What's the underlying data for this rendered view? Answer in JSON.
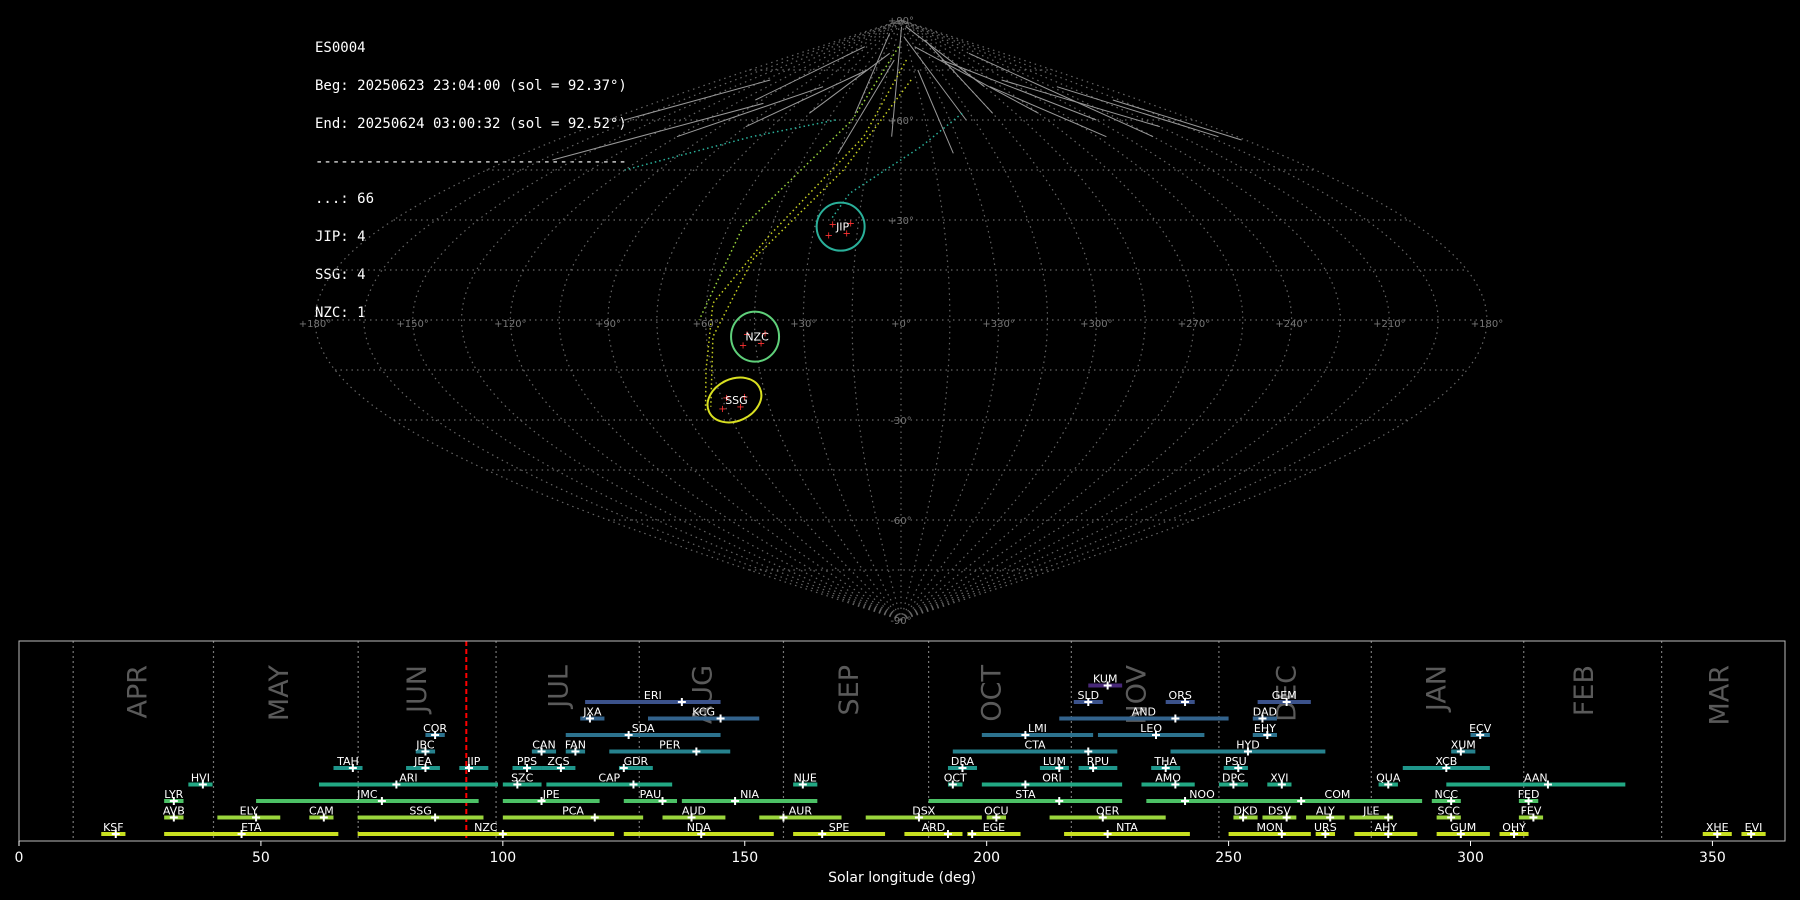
{
  "info": {
    "id": "ES0004",
    "beg": "Beg: 20250623 23:04:00 (sol = 92.37°)",
    "end": "End: 20250624 03:00:32 (sol = 92.52°)",
    "sep": "-------------------------------------",
    "counts": [
      "...: 66",
      "JIP: 4",
      "SSG: 4",
      "NZC: 1"
    ]
  },
  "sky_map": {
    "projection": "sinusoidal",
    "lat_labels": [
      "+90°",
      "+60°",
      "+30°",
      "-30°",
      "-60°",
      "-90°"
    ],
    "lon_labels": [
      "+180°",
      "+150°",
      "+120°",
      "+90°",
      "+60°",
      "+30°",
      "+0°",
      "+330°",
      "+300°",
      "+270°",
      "+240°",
      "+210°",
      "+180°"
    ],
    "radiants": [
      {
        "code": "JIP",
        "color": "#2ab09a"
      },
      {
        "code": "NZC",
        "color": "#5fd07a"
      },
      {
        "code": "SSG",
        "color": "#d9e021"
      }
    ]
  },
  "chart_data": {
    "type": "timeline",
    "xlabel": "Solar longitude (deg)",
    "xlim": [
      0,
      365
    ],
    "xticks": [
      0,
      50,
      100,
      150,
      200,
      250,
      300,
      350
    ],
    "current_sol": 92.45,
    "current_sol_color": "#ff0000",
    "month_labels": [
      {
        "label": "APR",
        "center": 24.5,
        "boundary": 11.2
      },
      {
        "label": "MAY",
        "center": 53.7,
        "boundary": 40.2
      },
      {
        "label": "JUN",
        "center": 82.3,
        "boundary": 70.1
      },
      {
        "label": "JUL",
        "center": 111.5,
        "boundary": 98.6
      },
      {
        "label": "AUG",
        "center": 141.3,
        "boundary": 128.2
      },
      {
        "label": "SEP",
        "center": 171.5,
        "boundary": 158.0
      },
      {
        "label": "OCT",
        "center": 201.0,
        "boundary": 188.0
      },
      {
        "label": "NOV",
        "center": 231.0,
        "boundary": 217.5
      },
      {
        "label": "DEC",
        "center": 262.0,
        "boundary": 248.0
      },
      {
        "label": "JAN",
        "center": 293.0,
        "boundary": 279.5
      },
      {
        "label": "FEB",
        "center": 323.5,
        "boundary": 311.0
      },
      {
        "label": "MAR",
        "center": 351.5,
        "boundary": 339.5
      }
    ],
    "showers": [
      {
        "code": "KSF",
        "start": 17,
        "end": 22,
        "peak": 20,
        "row": 0,
        "color": "#c8e020"
      },
      {
        "code": "ETA",
        "start": 30,
        "end": 66,
        "peak": 46,
        "row": 0,
        "color": "#c8e020"
      },
      {
        "code": "NZC",
        "start": 70,
        "end": 123,
        "peak": 100,
        "row": 0,
        "color": "#c8e020"
      },
      {
        "code": "NDA",
        "start": 125,
        "end": 156,
        "peak": 141,
        "row": 0,
        "color": "#c8e020"
      },
      {
        "code": "SPE",
        "start": 160,
        "end": 179,
        "peak": 166,
        "row": 0,
        "color": "#c8e020"
      },
      {
        "code": "ARD",
        "start": 183,
        "end": 195,
        "peak": 192,
        "row": 0,
        "color": "#c8e020"
      },
      {
        "code": "EGE",
        "start": 196,
        "end": 207,
        "peak": 197,
        "row": 0,
        "color": "#c8e020"
      },
      {
        "code": "NTA",
        "start": 216,
        "end": 242,
        "peak": 225,
        "row": 0,
        "color": "#c8e020"
      },
      {
        "code": "MON",
        "start": 250,
        "end": 267,
        "peak": 261,
        "row": 0,
        "color": "#c8e020"
      },
      {
        "code": "URS",
        "start": 268,
        "end": 272,
        "peak": 270,
        "row": 0,
        "color": "#c8e020"
      },
      {
        "code": "AHY",
        "start": 276,
        "end": 289,
        "peak": 283,
        "row": 0,
        "color": "#c8e020"
      },
      {
        "code": "GUM",
        "start": 293,
        "end": 304,
        "peak": 298,
        "row": 0,
        "color": "#c8e020"
      },
      {
        "code": "OHY",
        "start": 306,
        "end": 312,
        "peak": 309,
        "row": 0,
        "color": "#c8e020"
      },
      {
        "code": "XHE",
        "start": 348,
        "end": 354,
        "peak": 351,
        "row": 0,
        "color": "#c8e020"
      },
      {
        "code": "EVI",
        "start": 356,
        "end": 361,
        "peak": 358,
        "row": 0,
        "color": "#c8e020"
      },
      {
        "code": "AVB",
        "start": 30,
        "end": 34,
        "peak": 32,
        "row": 1,
        "color": "#9ad53c"
      },
      {
        "code": "ELY",
        "start": 41,
        "end": 54,
        "peak": 49,
        "row": 1,
        "color": "#9ad53c"
      },
      {
        "code": "CAM",
        "start": 60,
        "end": 65,
        "peak": 63,
        "row": 1,
        "color": "#9ad53c"
      },
      {
        "code": "SSG",
        "start": 70,
        "end": 96,
        "peak": 86,
        "row": 1,
        "color": "#9ad53c"
      },
      {
        "code": "PCA",
        "start": 100,
        "end": 129,
        "peak": 119,
        "row": 1,
        "color": "#9ad53c"
      },
      {
        "code": "AUD",
        "start": 133,
        "end": 146,
        "peak": 139,
        "row": 1,
        "color": "#9ad53c"
      },
      {
        "code": "AUR",
        "start": 153,
        "end": 170,
        "peak": 158,
        "row": 1,
        "color": "#9ad53c"
      },
      {
        "code": "DSX",
        "start": 175,
        "end": 199,
        "peak": 186,
        "row": 1,
        "color": "#9ad53c"
      },
      {
        "code": "OCU",
        "start": 200,
        "end": 204,
        "peak": 202,
        "row": 1,
        "color": "#9ad53c"
      },
      {
        "code": "OER",
        "start": 213,
        "end": 237,
        "peak": 224,
        "row": 1,
        "color": "#9ad53c"
      },
      {
        "code": "DKD",
        "start": 251,
        "end": 256,
        "peak": 253,
        "row": 1,
        "color": "#9ad53c"
      },
      {
        "code": "DSV",
        "start": 257,
        "end": 264,
        "peak": 262,
        "row": 1,
        "color": "#9ad53c"
      },
      {
        "code": "ALY",
        "start": 266,
        "end": 274,
        "peak": 271,
        "row": 1,
        "color": "#9ad53c"
      },
      {
        "code": "JLE",
        "start": 275,
        "end": 284,
        "peak": 283,
        "row": 1,
        "color": "#9ad53c"
      },
      {
        "code": "SCC",
        "start": 293,
        "end": 298,
        "peak": 296,
        "row": 1,
        "color": "#9ad53c"
      },
      {
        "code": "FEV",
        "start": 310,
        "end": 315,
        "peak": 313,
        "row": 1,
        "color": "#9ad53c"
      },
      {
        "code": "LYR",
        "start": 30,
        "end": 34,
        "peak": 32,
        "row": 2,
        "color": "#4cc166"
      },
      {
        "code": "JMC",
        "start": 49,
        "end": 95,
        "peak": 75,
        "row": 2,
        "color": "#4cc166"
      },
      {
        "code": "JPE",
        "start": 100,
        "end": 120,
        "peak": 108,
        "row": 2,
        "color": "#4cc166"
      },
      {
        "code": "PAU",
        "start": 125,
        "end": 136,
        "peak": 133,
        "row": 2,
        "color": "#4cc166"
      },
      {
        "code": "NIA",
        "start": 137,
        "end": 165,
        "peak": 148,
        "row": 2,
        "color": "#4cc166"
      },
      {
        "code": "STA",
        "start": 188,
        "end": 228,
        "peak": 215,
        "row": 2,
        "color": "#4cc166"
      },
      {
        "code": "NOO",
        "start": 233,
        "end": 256,
        "peak": 241,
        "row": 2,
        "color": "#4cc166"
      },
      {
        "code": "COM",
        "start": 255,
        "end": 290,
        "peak": 265,
        "row": 2,
        "color": "#4cc166"
      },
      {
        "code": "NCC",
        "start": 292,
        "end": 298,
        "peak": 296,
        "row": 2,
        "color": "#4cc166"
      },
      {
        "code": "FED",
        "start": 310,
        "end": 314,
        "peak": 312,
        "row": 2,
        "color": "#4cc166"
      },
      {
        "code": "HVI",
        "start": 35,
        "end": 40,
        "peak": 38,
        "row": 3,
        "color": "#22a884"
      },
      {
        "code": "ARI",
        "start": 62,
        "end": 99,
        "peak": 78,
        "row": 3,
        "color": "#22a884"
      },
      {
        "code": "SZC",
        "start": 100,
        "end": 108,
        "peak": 103,
        "row": 3,
        "color": "#22a884"
      },
      {
        "code": "CAP",
        "start": 109,
        "end": 135,
        "peak": 127,
        "row": 3,
        "color": "#22a884"
      },
      {
        "code": "NUE",
        "start": 160,
        "end": 165,
        "peak": 162,
        "row": 3,
        "color": "#22a884"
      },
      {
        "code": "OCT",
        "start": 192,
        "end": 195,
        "peak": 193,
        "row": 3,
        "color": "#22a884"
      },
      {
        "code": "ORI",
        "start": 199,
        "end": 228,
        "peak": 208,
        "row": 3,
        "color": "#22a884"
      },
      {
        "code": "AMO",
        "start": 232,
        "end": 243,
        "peak": 239,
        "row": 3,
        "color": "#22a884"
      },
      {
        "code": "DPC",
        "start": 248,
        "end": 254,
        "peak": 251,
        "row": 3,
        "color": "#22a884"
      },
      {
        "code": "XVI",
        "start": 258,
        "end": 263,
        "peak": 261,
        "row": 3,
        "color": "#22a884"
      },
      {
        "code": "QUA",
        "start": 281,
        "end": 285,
        "peak": 283,
        "row": 3,
        "color": "#22a884"
      },
      {
        "code": "AAN",
        "start": 295,
        "end": 332,
        "peak": 316,
        "row": 3,
        "color": "#22a884"
      },
      {
        "code": "TAH",
        "start": 65,
        "end": 71,
        "peak": 69,
        "row": 4,
        "color": "#1f968b"
      },
      {
        "code": "JEA",
        "start": 80,
        "end": 87,
        "peak": 84,
        "row": 4,
        "color": "#1f968b"
      },
      {
        "code": "JIP",
        "start": 91,
        "end": 97,
        "peak": 93,
        "row": 4,
        "color": "#1f968b"
      },
      {
        "code": "PPS",
        "start": 102,
        "end": 108,
        "peak": 105,
        "row": 4,
        "color": "#1f968b"
      },
      {
        "code": "ZCS",
        "start": 108,
        "end": 115,
        "peak": 112,
        "row": 4,
        "color": "#1f968b"
      },
      {
        "code": "GDR",
        "start": 124,
        "end": 131,
        "peak": 125,
        "row": 4,
        "color": "#1f968b"
      },
      {
        "code": "DRA",
        "start": 192,
        "end": 198,
        "peak": 195,
        "row": 4,
        "color": "#1f968b"
      },
      {
        "code": "LUM",
        "start": 211,
        "end": 217,
        "peak": 215,
        "row": 4,
        "color": "#1f968b"
      },
      {
        "code": "RPU",
        "start": 219,
        "end": 227,
        "peak": 222,
        "row": 4,
        "color": "#1f968b"
      },
      {
        "code": "THA",
        "start": 234,
        "end": 240,
        "peak": 237,
        "row": 4,
        "color": "#1f968b"
      },
      {
        "code": "PSU",
        "start": 249,
        "end": 254,
        "peak": 252,
        "row": 4,
        "color": "#1f968b"
      },
      {
        "code": "XCB",
        "start": 286,
        "end": 304,
        "peak": 295,
        "row": 4,
        "color": "#1f968b"
      },
      {
        "code": "JBC",
        "start": 82,
        "end": 86,
        "peak": 84,
        "row": 5,
        "color": "#26828e"
      },
      {
        "code": "CAN",
        "start": 106,
        "end": 111,
        "peak": 108,
        "row": 5,
        "color": "#26828e"
      },
      {
        "code": "FAN",
        "start": 113,
        "end": 117,
        "peak": 115,
        "row": 5,
        "color": "#26828e"
      },
      {
        "code": "PER",
        "start": 122,
        "end": 147,
        "peak": 140,
        "row": 5,
        "color": "#26828e"
      },
      {
        "code": "CTA",
        "start": 193,
        "end": 227,
        "peak": 221,
        "row": 5,
        "color": "#26828e"
      },
      {
        "code": "HYD",
        "start": 238,
        "end": 270,
        "peak": 254,
        "row": 5,
        "color": "#26828e"
      },
      {
        "code": "XUM",
        "start": 296,
        "end": 301,
        "peak": 298,
        "row": 5,
        "color": "#26828e"
      },
      {
        "code": "COR",
        "start": 84,
        "end": 88,
        "peak": 86,
        "row": 6,
        "color": "#2c728e"
      },
      {
        "code": "SDA",
        "start": 113,
        "end": 145,
        "peak": 126,
        "row": 6,
        "color": "#2c728e"
      },
      {
        "code": "LMI",
        "start": 199,
        "end": 222,
        "peak": 208,
        "row": 6,
        "color": "#2c728e"
      },
      {
        "code": "LEO",
        "start": 223,
        "end": 245,
        "peak": 235,
        "row": 6,
        "color": "#2c728e"
      },
      {
        "code": "EHY",
        "start": 255,
        "end": 260,
        "peak": 258,
        "row": 6,
        "color": "#2c728e"
      },
      {
        "code": "ECV",
        "start": 300,
        "end": 304,
        "peak": 302,
        "row": 6,
        "color": "#2c728e"
      },
      {
        "code": "JXA",
        "start": 116,
        "end": 121,
        "peak": 118,
        "row": 7,
        "color": "#33638d"
      },
      {
        "code": "KCG",
        "start": 130,
        "end": 153,
        "peak": 145,
        "row": 7,
        "color": "#33638d"
      },
      {
        "code": "AND",
        "start": 215,
        "end": 250,
        "peak": 239,
        "row": 7,
        "color": "#33638d"
      },
      {
        "code": "DAD",
        "start": 255,
        "end": 260,
        "peak": 257,
        "row": 7,
        "color": "#33638d"
      },
      {
        "code": "ERI",
        "start": 117,
        "end": 145,
        "peak": 137,
        "row": 8,
        "color": "#3b528b"
      },
      {
        "code": "SLD",
        "start": 218,
        "end": 224,
        "peak": 221,
        "row": 8,
        "color": "#3b528b"
      },
      {
        "code": "ORS",
        "start": 237,
        "end": 243,
        "peak": 241,
        "row": 8,
        "color": "#3b528b"
      },
      {
        "code": "GEM",
        "start": 256,
        "end": 267,
        "peak": 262,
        "row": 8,
        "color": "#3b528b"
      },
      {
        "code": "KUM",
        "start": 221,
        "end": 228,
        "peak": 225,
        "row": 9,
        "color": "#482878"
      }
    ]
  }
}
